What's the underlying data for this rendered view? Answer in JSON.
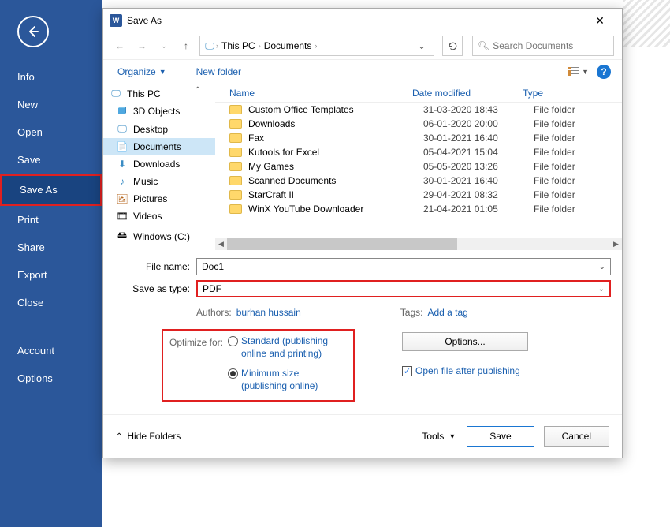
{
  "backstage": {
    "items": [
      "Info",
      "New",
      "Open",
      "Save",
      "Save As",
      "Print",
      "Share",
      "Export",
      "Close",
      "Account",
      "Options"
    ]
  },
  "dialog": {
    "title": "Save As",
    "breadcrumbs": [
      "This PC",
      "Documents"
    ],
    "search_placeholder": "Search Documents",
    "organize": "Organize",
    "new_folder": "New folder"
  },
  "tree": [
    "This PC",
    "3D Objects",
    "Desktop",
    "Documents",
    "Downloads",
    "Music",
    "Pictures",
    "Videos",
    "Windows (C:)"
  ],
  "columns": {
    "name": "Name",
    "date": "Date modified",
    "type": "Type"
  },
  "files": [
    {
      "name": "Custom Office Templates",
      "date": "31-03-2020 18:43",
      "type": "File folder"
    },
    {
      "name": "Downloads",
      "date": "06-01-2020 20:00",
      "type": "File folder"
    },
    {
      "name": "Fax",
      "date": "30-01-2021 16:40",
      "type": "File folder"
    },
    {
      "name": "Kutools for Excel",
      "date": "05-04-2021 15:04",
      "type": "File folder"
    },
    {
      "name": "My Games",
      "date": "05-05-2020 13:26",
      "type": "File folder"
    },
    {
      "name": "Scanned Documents",
      "date": "30-01-2021 16:40",
      "type": "File folder"
    },
    {
      "name": "StarCraft II",
      "date": "29-04-2021 08:32",
      "type": "File folder"
    },
    {
      "name": "WinX YouTube Downloader",
      "date": "21-04-2021 01:05",
      "type": "File folder"
    }
  ],
  "form": {
    "file_name_label": "File name:",
    "file_name": "Doc1",
    "type_label": "Save as type:",
    "type": "PDF",
    "authors_label": "Authors:",
    "authors": "burhan hussain",
    "tags_label": "Tags:",
    "tags": "Add a tag",
    "optimize_label": "Optimize for:",
    "opt_standard": "Standard (publishing online and printing)",
    "opt_minimum": "Minimum size (publishing online)",
    "options_btn": "Options...",
    "open_after": "Open file after publishing"
  },
  "footer": {
    "hide_folders": "Hide Folders",
    "tools": "Tools",
    "save": "Save",
    "cancel": "Cancel"
  }
}
